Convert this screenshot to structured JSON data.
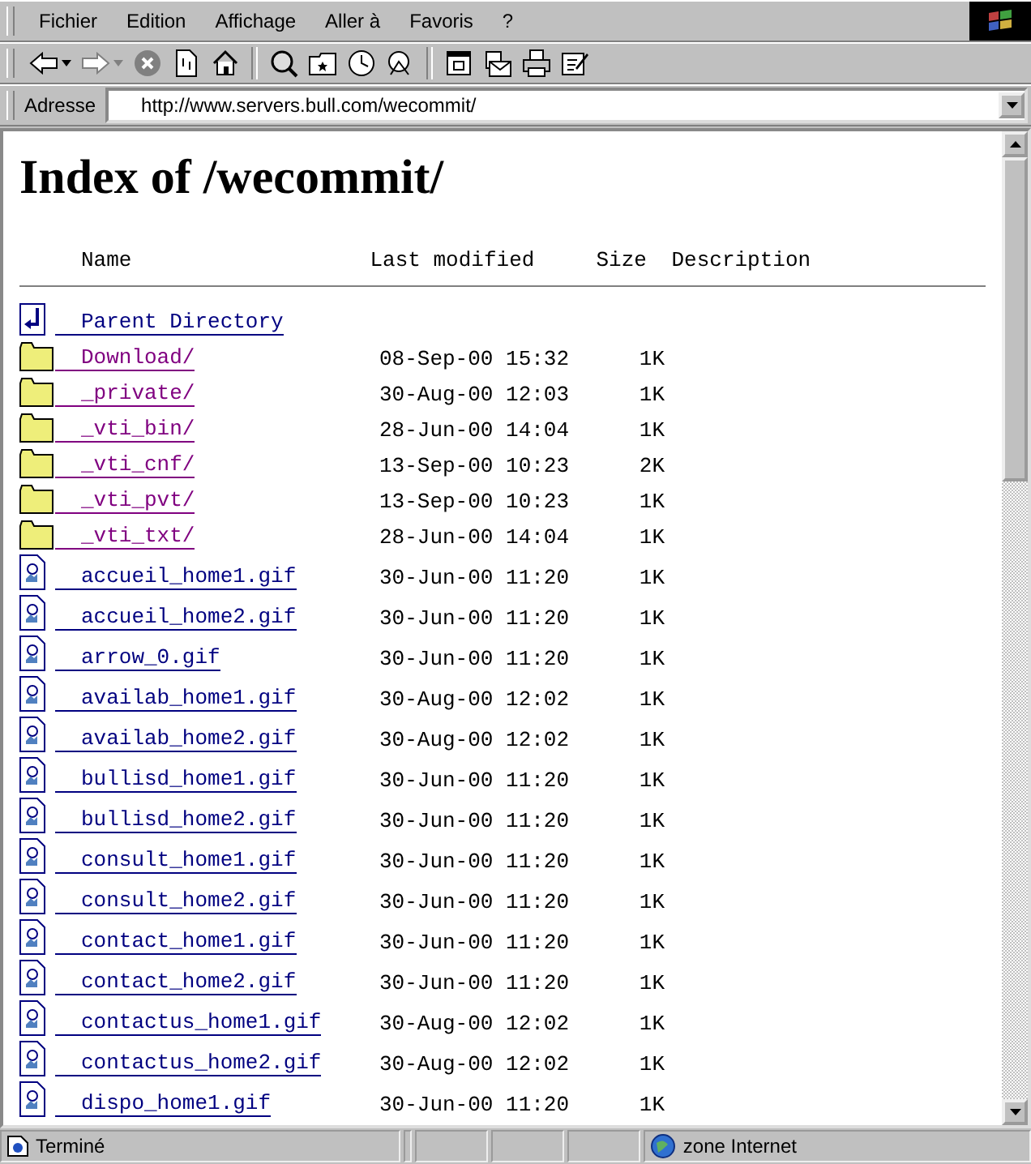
{
  "menu": [
    "Fichier",
    "Edition",
    "Affichage",
    "Aller à",
    "Favoris",
    "?"
  ],
  "toolbar": [
    {
      "kind": "back",
      "dropdown": true,
      "disabled": false
    },
    {
      "kind": "forward",
      "dropdown": true,
      "disabled": true
    },
    {
      "kind": "stop"
    },
    {
      "kind": "refresh"
    },
    {
      "kind": "home"
    },
    {
      "kind": "sep"
    },
    {
      "kind": "search"
    },
    {
      "kind": "favorites"
    },
    {
      "kind": "history"
    },
    {
      "kind": "channels"
    },
    {
      "kind": "sep"
    },
    {
      "kind": "fullscreen"
    },
    {
      "kind": "mail"
    },
    {
      "kind": "print"
    },
    {
      "kind": "edit"
    }
  ],
  "address": {
    "label": "Adresse",
    "value": "http://www.servers.bull.com/wecommit/"
  },
  "page": {
    "title": "Index of /wecommit/",
    "columns": [
      "Name",
      "Last modified",
      "Size",
      "Description"
    ],
    "items": [
      {
        "kind": "parent",
        "name": "Parent Directory",
        "visited": false
      },
      {
        "kind": "folder",
        "name": "Download/",
        "visited": true,
        "date": "08-Sep-00 15:32",
        "size": "1K"
      },
      {
        "kind": "folder",
        "name": "_private/",
        "visited": true,
        "date": "30-Aug-00 12:03",
        "size": "1K"
      },
      {
        "kind": "folder",
        "name": "_vti_bin/",
        "visited": true,
        "date": "28-Jun-00 14:04",
        "size": "1K"
      },
      {
        "kind": "folder",
        "name": "_vti_cnf/",
        "visited": true,
        "date": "13-Sep-00 10:23",
        "size": "2K"
      },
      {
        "kind": "folder",
        "name": "_vti_pvt/",
        "visited": true,
        "date": "13-Sep-00 10:23",
        "size": "1K"
      },
      {
        "kind": "folder",
        "name": "_vti_txt/",
        "visited": true,
        "date": "28-Jun-00 14:04",
        "size": "1K"
      },
      {
        "kind": "file",
        "name": "accueil_home1.gif",
        "visited": false,
        "date": "30-Jun-00 11:20",
        "size": "1K"
      },
      {
        "kind": "file",
        "name": "accueil_home2.gif",
        "visited": false,
        "date": "30-Jun-00 11:20",
        "size": "1K"
      },
      {
        "kind": "file",
        "name": "arrow_0.gif",
        "visited": false,
        "date": "30-Jun-00 11:20",
        "size": "1K"
      },
      {
        "kind": "file",
        "name": "availab_home1.gif",
        "visited": false,
        "date": "30-Aug-00 12:02",
        "size": "1K"
      },
      {
        "kind": "file",
        "name": "availab_home2.gif",
        "visited": false,
        "date": "30-Aug-00 12:02",
        "size": "1K"
      },
      {
        "kind": "file",
        "name": "bullisd_home1.gif",
        "visited": false,
        "date": "30-Jun-00 11:20",
        "size": "1K"
      },
      {
        "kind": "file",
        "name": "bullisd_home2.gif",
        "visited": false,
        "date": "30-Jun-00 11:20",
        "size": "1K"
      },
      {
        "kind": "file",
        "name": "consult_home1.gif",
        "visited": false,
        "date": "30-Jun-00 11:20",
        "size": "1K"
      },
      {
        "kind": "file",
        "name": "consult_home2.gif",
        "visited": false,
        "date": "30-Jun-00 11:20",
        "size": "1K"
      },
      {
        "kind": "file",
        "name": "contact_home1.gif",
        "visited": false,
        "date": "30-Jun-00 11:20",
        "size": "1K"
      },
      {
        "kind": "file",
        "name": "contact_home2.gif",
        "visited": false,
        "date": "30-Jun-00 11:20",
        "size": "1K"
      },
      {
        "kind": "file",
        "name": "contactus_home1.gif",
        "visited": false,
        "date": "30-Aug-00 12:02",
        "size": "1K"
      },
      {
        "kind": "file",
        "name": "contactus_home2.gif",
        "visited": false,
        "date": "30-Aug-00 12:02",
        "size": "1K"
      },
      {
        "kind": "file",
        "name": "dispo_home1.gif",
        "visited": false,
        "date": "30-Jun-00 11:20",
        "size": "1K"
      }
    ]
  },
  "status_bar": {
    "text": "Terminé",
    "zone": "zone Internet"
  }
}
